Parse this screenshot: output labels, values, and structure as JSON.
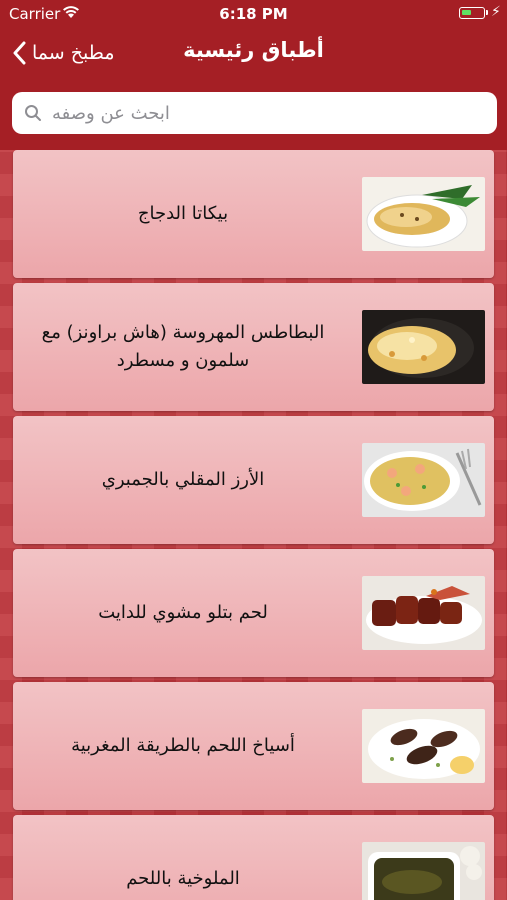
{
  "status_bar": {
    "carrier": "Carrier",
    "time": "6:18 PM",
    "battery_level": 0.45
  },
  "nav": {
    "back_label": "مطبخ سما",
    "title": "أطباق رئيسية"
  },
  "search": {
    "placeholder": "ابحث عن وصفه",
    "value": ""
  },
  "recipes": [
    {
      "title": "بيكاتا الدجاج",
      "image": "chicken-piccata-photo"
    },
    {
      "title": "البطاطس المهروسة (هاش براونز) مع سلمون و مسطرد",
      "image": "hash-browns-salmon-photo"
    },
    {
      "title": "الأرز المقلي بالجمبري",
      "image": "shrimp-fried-rice-photo"
    },
    {
      "title": "لحم بتلو مشوي للدايت",
      "image": "grilled-veal-photo"
    },
    {
      "title": "أسياخ اللحم بالطريقة المغربية",
      "image": "moroccan-kebab-photo"
    },
    {
      "title": "الملوخية باللحم",
      "image": "molokhia-photo"
    }
  ],
  "colors": {
    "nav_bg": "#a51f25",
    "card_bg": "#f2c3c5",
    "list_bg": "#c0353b"
  }
}
